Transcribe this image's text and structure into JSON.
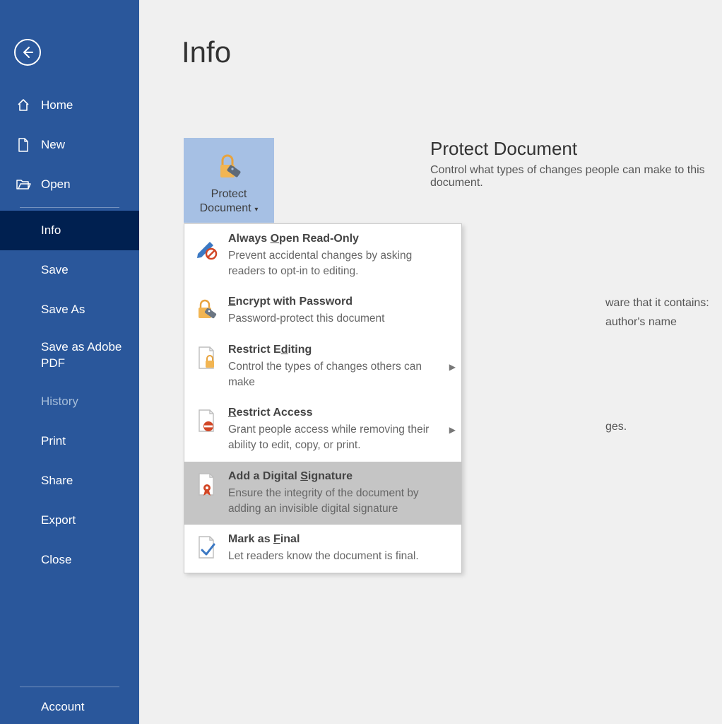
{
  "page": {
    "title": "Info"
  },
  "sidebar": {
    "home": "Home",
    "new": "New",
    "open": "Open",
    "info": "Info",
    "save": "Save",
    "save_as": "Save As",
    "save_adobe": "Save as Adobe PDF",
    "history": "History",
    "print": "Print",
    "share": "Share",
    "export": "Export",
    "close": "Close",
    "account": "Account"
  },
  "protect_button": {
    "line1": "Protect",
    "line2": "Document"
  },
  "section_protect": {
    "heading": "Protect Document",
    "desc": "Control what types of changes people can make to this document."
  },
  "behind": {
    "line1": "ware that it contains:",
    "line2": "author's name",
    "line3": "ges."
  },
  "menu": {
    "read_only": {
      "title_pre": "Always ",
      "title_ul": "O",
      "title_post": "pen Read-Only",
      "desc": "Prevent accidental changes by asking readers to opt-in to editing."
    },
    "encrypt": {
      "title_ul": "E",
      "title_post": "ncrypt with Password",
      "desc": "Password-protect this document"
    },
    "restrict_edit": {
      "title_pre": "Restrict E",
      "title_ul": "d",
      "title_post": "iting",
      "desc": "Control the types of changes others can make"
    },
    "restrict_access": {
      "title_ul": "R",
      "title_post": "estrict Access",
      "desc": "Grant people access while removing their ability to edit, copy, or print."
    },
    "digital_sig": {
      "title_pre": "Add a Digital ",
      "title_ul": "S",
      "title_post": "ignature",
      "desc": "Ensure the integrity of the document by adding an invisible digital signature"
    },
    "mark_final": {
      "title_pre": "Mark as ",
      "title_ul": "F",
      "title_post": "inal",
      "desc": "Let readers know the document is final."
    }
  }
}
